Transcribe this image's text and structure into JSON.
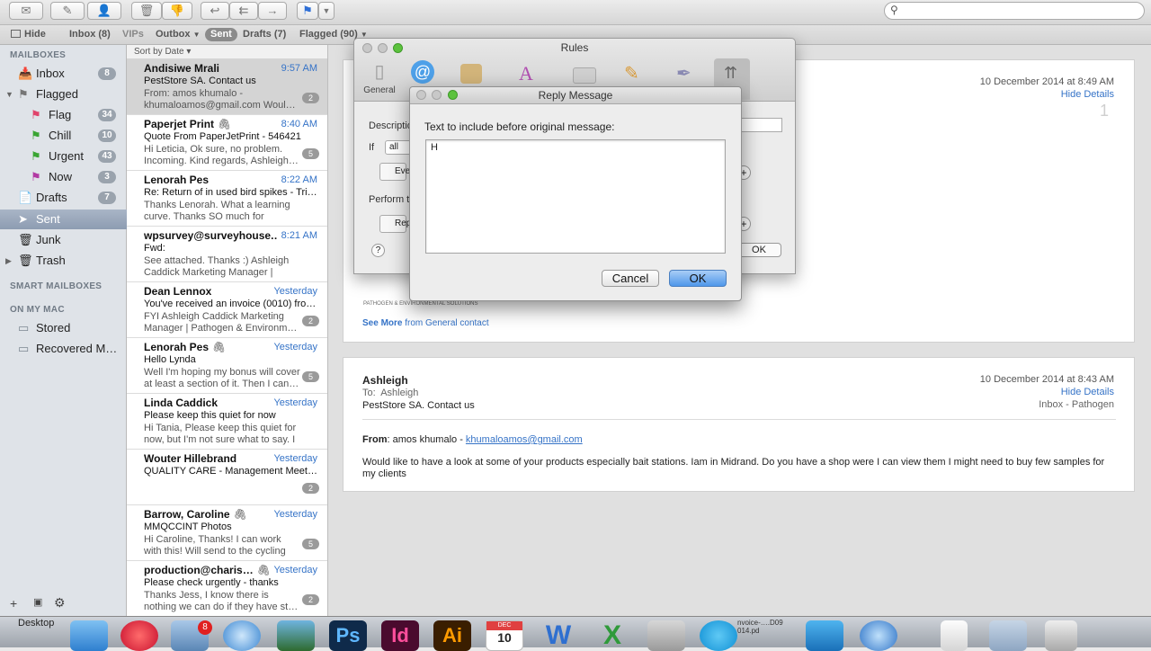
{
  "toolbar": {
    "icons": [
      "mail-icon",
      "compose-icon",
      "contact-icon",
      "trash-icon",
      "thumbs-down-icon",
      "reply-icon",
      "reply-all-icon",
      "forward-icon",
      "flag-icon",
      "dropdown-icon"
    ]
  },
  "favorites": {
    "hide": "Hide",
    "inbox": "Inbox (8)",
    "vips": "VIPs",
    "outbox": "Outbox",
    "sent": "Sent",
    "drafts": "Drafts (7)",
    "flagged": "Flagged (90)"
  },
  "sidebar": {
    "mailboxes_header": "MAILBOXES",
    "inbox": {
      "label": "Inbox",
      "count": "8"
    },
    "flagged": {
      "label": "Flagged"
    },
    "flag": {
      "label": "Flag",
      "count": "34",
      "color": "#e0436b"
    },
    "chill": {
      "label": "Chill",
      "count": "10",
      "color": "#3aa533"
    },
    "urgent": {
      "label": "Urgent",
      "count": "43",
      "color": "#3aa533"
    },
    "now": {
      "label": "Now",
      "count": "3",
      "color": "#b23aa3"
    },
    "drafts": {
      "label": "Drafts",
      "count": "7"
    },
    "sent": {
      "label": "Sent"
    },
    "junk": {
      "label": "Junk"
    },
    "trash": {
      "label": "Trash"
    },
    "smart_header": "SMART MAILBOXES",
    "onmymac_header": "ON MY MAC",
    "stored": {
      "label": "Stored"
    },
    "recovered": {
      "label": "Recovered M…"
    }
  },
  "message_list": {
    "sort_label": "Sort by Date ▾",
    "messages": [
      {
        "from": "Andisiwe Mrali",
        "time": "9:57 AM",
        "subject": "PestStore SA. Contact us",
        "preview": "From: amos khumalo - khumaloamos@gmail.com Woul…",
        "thread": "2"
      },
      {
        "from": "Paperjet Print",
        "time": "8:40 AM",
        "subject": "Quote From PaperJetPrint - 546421",
        "preview": "Hi Leticia, Ok sure, no problem. Incoming. Kind regards, Ashleigh…",
        "thread": "5"
      },
      {
        "from": "Lenorah Pes",
        "time": "8:22 AM",
        "subject": "Re: Return of in used bird spikes - Tri…",
        "preview": "Thanks Lenorah. What a learning curve. Thanks SO much for handling this! As…",
        "thread": ""
      },
      {
        "from": "wpsurvey@surveyhouse.…",
        "time": "8:21 AM",
        "subject": "Fwd:",
        "preview": "See attached. Thanks :) Ashleigh Caddick Marketing Manager | Pathoge…",
        "thread": ""
      },
      {
        "from": "Dean Lennox",
        "time": "Yesterday",
        "subject": "You've received an invoice (0010) fro…",
        "preview": "FYI Ashleigh Caddick Marketing Manager | Pathogen & Environm…",
        "thread": "2"
      },
      {
        "from": "Lenorah Pes",
        "time": "Yesterday",
        "subject": "Hello Lynda",
        "preview": "Well I'm hoping my bonus will cover at least a section of it. Then I can…",
        "thread": "5"
      },
      {
        "from": "Linda Caddick",
        "time": "Yesterday",
        "subject": "Please keep this quiet for now",
        "preview": "Hi Tania, Please keep this quiet for now, but I'm not sure what to say. I expecte…",
        "thread": ""
      },
      {
        "from": "Wouter Hillebrand",
        "time": "Yesterday",
        "subject": "QUALITY CARE - Management Meet…",
        "preview": "",
        "thread": "2"
      },
      {
        "from": "Barrow, Caroline",
        "time": "Yesterday",
        "subject": "MMQCCINT Photos",
        "preview": "Hi Caroline, Thanks! I can work with this! Will send to the cycling peopl…",
        "thread": "5"
      },
      {
        "from": "production@charis…",
        "time": "Yesterday",
        "subject": "Please check urgently - thanks",
        "preview": "Thanks Jess, I know there is nothing we can do if they have st…",
        "thread": "2"
      }
    ]
  },
  "content": {
    "email1": {
      "date": "10 December 2014 at 8:49 AM",
      "hide_details": "Hide Details",
      "number": "1",
      "footer_small": "PATHOGEN & ENVIRONMENTAL SOLUTIONS",
      "see_more": "See More",
      "see_more_from": "from General contact"
    },
    "email2": {
      "sender": "Ashleigh",
      "to_label": "To:",
      "to": "Ashleigh",
      "subject": "PestStore SA. Contact us",
      "date": "10 December 2014 at 8:43 AM",
      "hide_details": "Hide Details",
      "mailbox": "Inbox - Pathogen",
      "from_label": "From",
      "from_name": ": amos khumalo - ",
      "from_email": "khumaloamos@gmail.com",
      "body": "Would like to have a look at some of your products especially bait stations. Iam in Midrand. Do you have a shop were I can view them I might need to buy few samples for my clients"
    }
  },
  "rules_window": {
    "title": "Rules",
    "tabs": [
      {
        "label": "General"
      },
      {
        "label": "A"
      }
    ],
    "description_label": "Descriptio",
    "if_label": "If",
    "if_value": "all",
    "every_label": "Eve",
    "perform_label": "Perform t",
    "reply_label": "Rep",
    "ok_label": "OK",
    "help_label": "?"
  },
  "reply_dialog": {
    "title": "Reply Message",
    "prompt": "Text to include before original message:",
    "text": "H",
    "cancel": "Cancel",
    "ok": "OK"
  },
  "dock": {
    "desktop_label": "Desktop",
    "badge": "8",
    "ps": "Ps",
    "id": "Id",
    "ai": "Ai",
    "cal_month": "DEC",
    "cal_day": "10",
    "file_label": "nvoice-….D09  014.pd"
  }
}
